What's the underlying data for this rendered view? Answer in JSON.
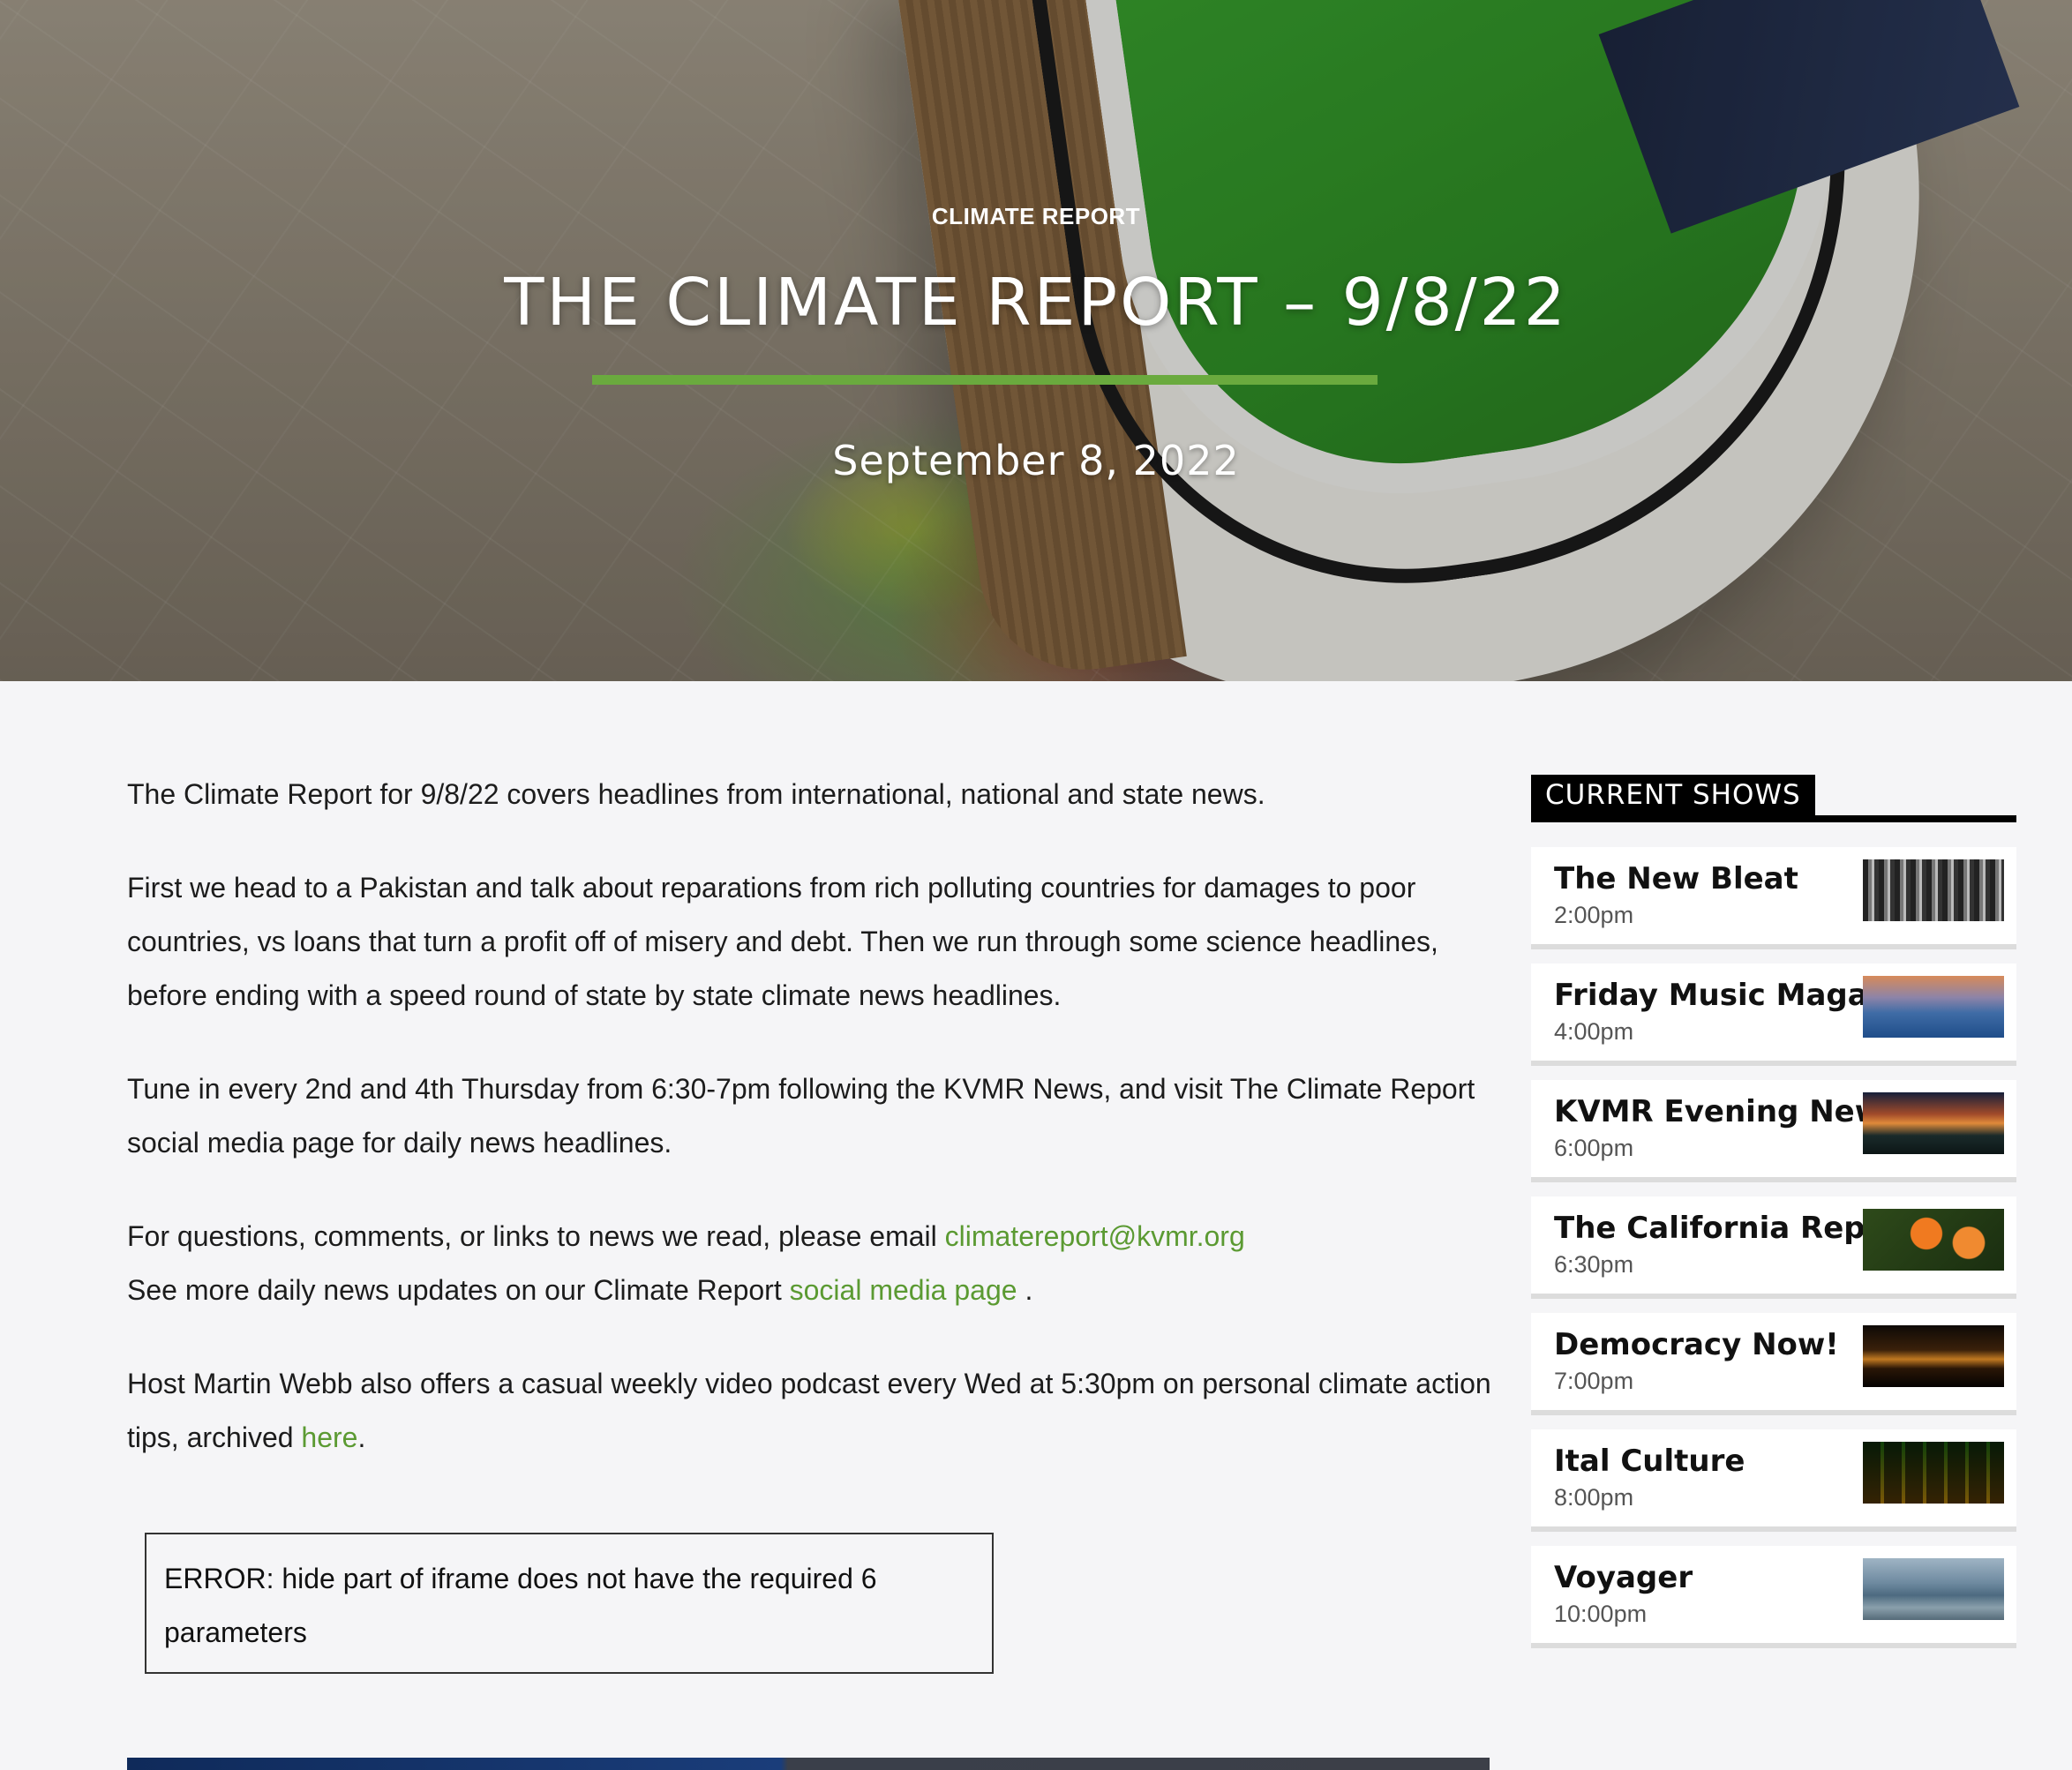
{
  "hero": {
    "category": "CLIMATE REPORT",
    "title": "THE CLIMATE REPORT – 9/8/22",
    "date": "September 8, 2022",
    "accent_color": "#6aaa3e"
  },
  "article": {
    "p1": "The Climate Report for 9/8/22 covers headlines from international, national and state news.",
    "p2": "First we head to a Pakistan and talk about reparations from rich polluting countries for damages to poor countries, vs loans that turn a profit off of misery and debt. Then we run through some science headlines, before ending with a speed round of state by state climate news headlines.",
    "p3": "Tune in every 2nd and 4th Thursday from 6:30-7pm following the KVMR News, and visit The Climate Report social media page for daily news headlines.",
    "p4_prefix": "For questions, comments, or links to news we read, please email ",
    "p4_email": "climatereport@kvmr.org",
    "p4_line2_prefix": "See more daily news updates on our Climate Report ",
    "p4_link": "social media page",
    "p4_line2_suffix": " .",
    "p5_prefix": "Host Martin Webb also offers a casual weekly video podcast every Wed at 5:30pm on personal climate action tips, archived ",
    "p5_link": "here",
    "p5_suffix": ".",
    "link_color": "#5b9a32"
  },
  "error_box": {
    "text": "ERROR: hide part of iframe does not have the required 6 parameters"
  },
  "sidebar": {
    "heading": "CURRENT SHOWS",
    "shows": [
      {
        "name": "The New Bleat",
        "time": "2:00pm"
      },
      {
        "name": "Friday Music Magazine",
        "time": "4:00pm"
      },
      {
        "name": "KVMR Evening News",
        "time": "6:00pm"
      },
      {
        "name": "The California Report",
        "time": "6:30pm"
      },
      {
        "name": "Democracy Now!",
        "time": "7:00pm"
      },
      {
        "name": "Ital Culture",
        "time": "8:00pm"
      },
      {
        "name": "Voyager",
        "time": "10:00pm"
      }
    ]
  }
}
